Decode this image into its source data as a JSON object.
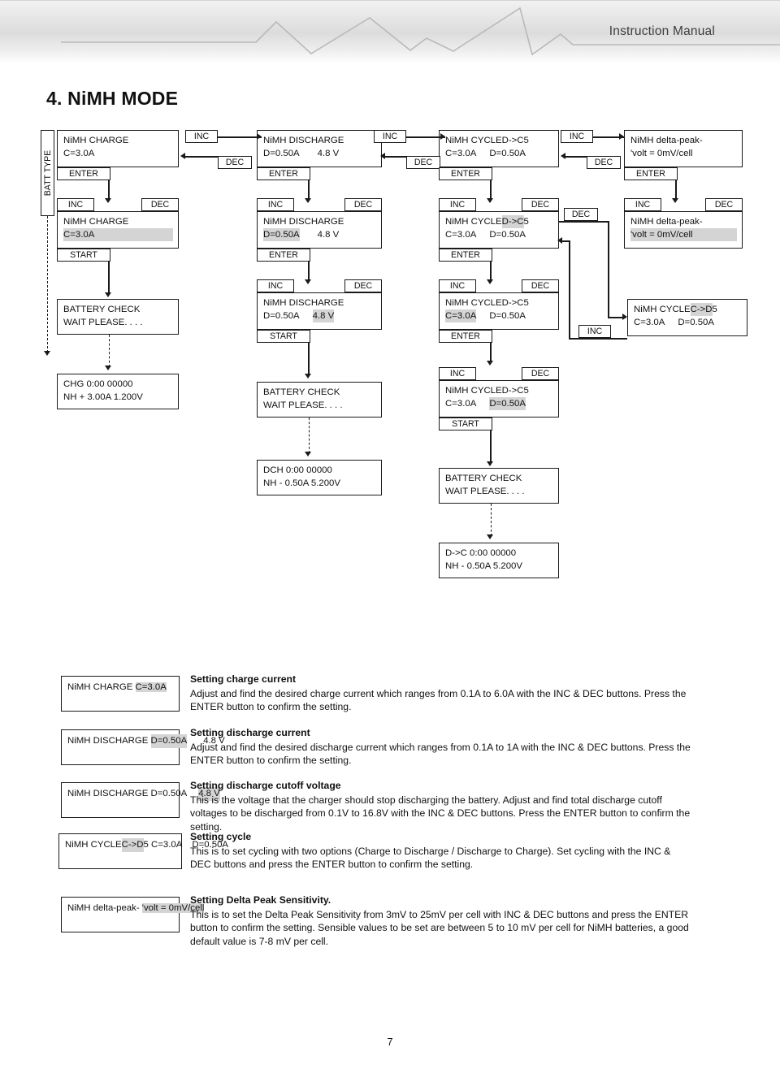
{
  "header": {
    "manual_label": "Instruction Manual"
  },
  "page": {
    "title": "4. NiMH MODE",
    "number": "7"
  },
  "labels": {
    "batt_type": "BATT TYPE",
    "inc": "INC",
    "dec": "DEC",
    "enter": "ENTER",
    "start": "START"
  },
  "flow": {
    "charge_setup": {
      "l1": "NiMH CHARGE",
      "l2": "C=3.0A"
    },
    "charge_confirm": {
      "l1": "NiMH CHARGE",
      "l2": "C=3.0A"
    },
    "discharge_setup": {
      "l1": "NiMH DISCHARGE",
      "l2a": "D=0.50A",
      "l2b": "4.8 V"
    },
    "discharge_current": {
      "l1": "NiMH DISCHARGE",
      "l2a": "D=0.50A",
      "l2b": "4.8 V"
    },
    "discharge_cutoff": {
      "l1": "NiMH DISCHARGE",
      "l2a": "D=0.50A",
      "l2b": "4.8 V"
    },
    "cycle_setup": {
      "l1a": "NiMH CYCLE ",
      "l1b": "D->C",
      "l1c": " 5",
      "l2a": "C=3.0A",
      "l2b": "D=0.50A"
    },
    "cycle_mode": {
      "l1a": "NiMH CYCLE ",
      "l1b": "D->C",
      "l1c": " 5",
      "l2a": "C=3.0A",
      "l2b": "D=0.50A"
    },
    "cycle_charge_cur": {
      "l1a": "NiMH CYCLE ",
      "l1b": "D->C",
      "l1c": " 5",
      "l2a": "C=3.0A",
      "l2b": "D=0.50A"
    },
    "cycle_dis_cur": {
      "l1a": "NiMH CYCLE ",
      "l1b": "D->C",
      "l1c": " 5",
      "l2a": "C=3.0A",
      "l2b": "D=0.50A"
    },
    "cycle_cd": {
      "l1a": "NiMH CYCLE ",
      "l1b": "C->D",
      "l1c": " 5",
      "l2a": "C=3.0A",
      "l2b": "D=0.50A"
    },
    "delta_peak_setup": {
      "l1": "NiMH delta-peak-",
      "l2": "'volt = 0mV/cell"
    },
    "delta_peak_value": {
      "l1": "NiMH delta-peak-",
      "l2": "'volt = 0mV/cell"
    },
    "battery_check_chg": {
      "l1": "BATTERY CHECK",
      "l2": "WAIT PLEASE. . . ."
    },
    "battery_check_dch": {
      "l1": "BATTERY CHECK",
      "l2": "WAIT PLEASE. . . ."
    },
    "battery_check_cyc": {
      "l1": "BATTERY CHECK",
      "l2": "WAIT PLEASE. . . ."
    },
    "running_chg": {
      "l1": "CHG  0:00   00000",
      "l2": "NH + 3.00A 1.200V"
    },
    "running_dch": {
      "l1": "DCH  0:00   00000",
      "l2": "NH - 0.50A 5.200V"
    },
    "running_cycle": {
      "l1": "D->C 0:00   00000",
      "l2": "NH  - 0.50A 5.200V"
    }
  },
  "legend": [
    {
      "box": {
        "l1": "NiMH CHARGE",
        "l2": "C=3.0A"
      },
      "heading": "Setting charge current",
      "body": "Adjust and find the desired charge current which ranges from 0.1A to 6.0A with the INC & DEC buttons. Press the ENTER button to confirm the setting."
    },
    {
      "box": {
        "l1": "NiMH DISCHARGE",
        "l2a": "D=0.50A",
        "l2b": "4.8 V"
      },
      "heading": "Setting discharge current",
      "body": "Adjust and find the desired discharge current which ranges from 0.1A to 1A with the INC & DEC buttons. Press the ENTER button to confirm the setting."
    },
    {
      "box": {
        "l1": "NiMH DISCHARGE",
        "l2a": "D=0.50A",
        "l2b": "4.8 V"
      },
      "heading": "Setting discharge cutoff voltage",
      "body": "This is the voltage that the charger should stop discharging the battery. Adjust and find total discharge cutoff voltages to be discharged from 0.1V to 16.8V with the INC & DEC buttons. Press the ENTER button to confirm the setting."
    },
    {
      "box": {
        "l1a": "NiMH CYCLE ",
        "l1b": "C->D",
        "l1c": " 5",
        "l2a": "C=3.0A",
        "l2b": "D=0.50A"
      },
      "heading": "Setting cycle",
      "body": "This is to set cycling with two options (Charge to Discharge / Discharge to Charge). Set cycling with the INC & DEC buttons and press the ENTER button to confirm the setting."
    },
    {
      "box": {
        "l1": "NiMH delta-peak-",
        "l2": "'volt = 0mV/cell"
      },
      "heading": "Setting Delta Peak Sensitivity.",
      "body": "This is to set the Delta Peak Sensitivity from 3mV to 25mV per cell with INC & DEC buttons and press the ENTER button to confirm the setting. Sensible values to be set are between 5 to 10 mV per cell for NiMH batteries, a good default value is 7-8 mV per cell."
    }
  ]
}
